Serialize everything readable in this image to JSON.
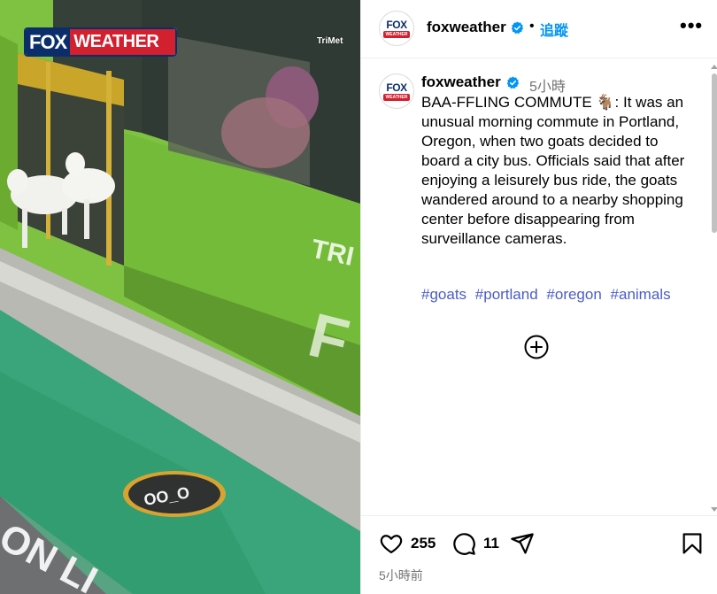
{
  "media": {
    "logo_fox": "FOX",
    "logo_weather": "WEATHER",
    "watermark": "TriMet",
    "bus_text": "TRI",
    "ground_marking": "ON LI",
    "circle_text": "OO_O"
  },
  "header": {
    "avatar_fox": "FOX",
    "avatar_weather": "WEATHER",
    "username": "foxweather",
    "separator": "•",
    "follow_label": "追蹤",
    "more_label": "•••"
  },
  "caption": {
    "avatar_fox": "FOX",
    "avatar_weather": "WEATHER",
    "username": "foxweather",
    "time_ago": "5小時",
    "text": "BAA-FFLING COMMUTE 🐐: It was an unusual morning commute in Portland, Oregon, when two goats decided to board a city bus. Officials said that after enjoying a leisurely bus ride, the goats wandered around to a nearby shopping center before disappearing from surveillance cameras.",
    "hashtags": [
      "#goats",
      "#portland",
      "#oregon",
      "#animals"
    ]
  },
  "actions": {
    "likes": "255",
    "comments": "11",
    "posted_ago": "5小時前"
  },
  "icons": {
    "verified": "verified-badge-icon",
    "like": "heart-icon",
    "comment": "comment-bubble-icon",
    "share": "paper-plane-icon",
    "save": "bookmark-icon",
    "load_more": "plus-circle-icon",
    "more": "ellipsis-icon"
  },
  "colors": {
    "link_blue": "#0095f6",
    "hashtag": "#4a5cc8",
    "verified": "#0095f6",
    "fox_navy": "#0b2e6b",
    "fox_red": "#d2202f",
    "bus_green": "#7fc242"
  }
}
